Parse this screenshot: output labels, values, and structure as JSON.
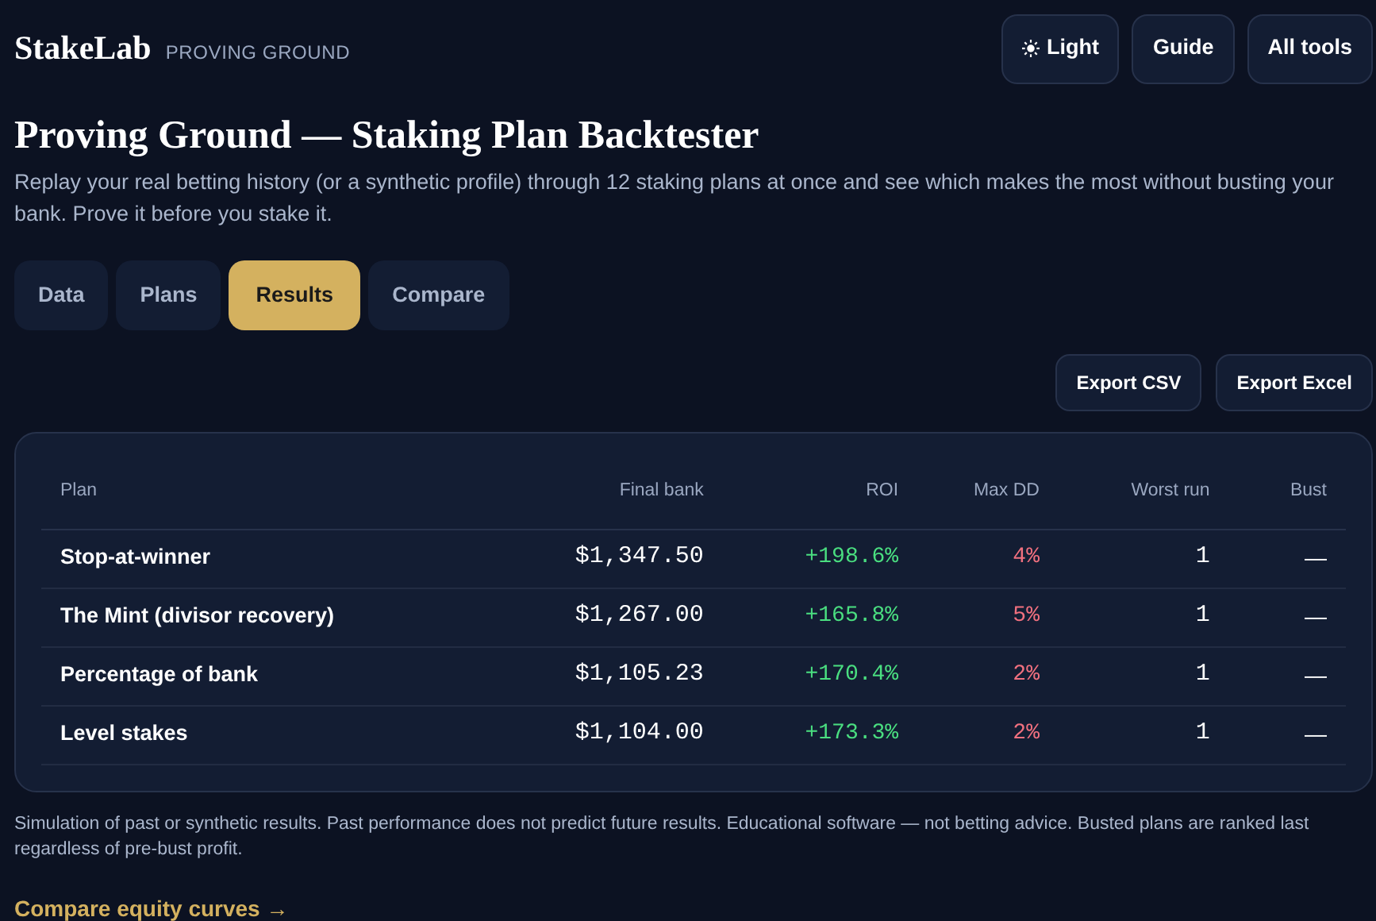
{
  "header": {
    "brand": "StakeLab",
    "subtitle": "PROVING GROUND",
    "buttons": [
      {
        "kind": "theme",
        "label": "Light"
      },
      {
        "kind": "plain",
        "label": "Guide"
      },
      {
        "kind": "plain",
        "label": "All tools"
      }
    ]
  },
  "title": "Proving Ground — Staking Plan Backtester",
  "description": "Replay your real betting history (or a synthetic profile) through 12 staking plans at once and see which makes the most without busting your bank. Prove it before you stake it.",
  "tabs": [
    {
      "label": "Data",
      "selected": false
    },
    {
      "label": "Plans",
      "selected": false
    },
    {
      "label": "Results",
      "selected": true
    },
    {
      "label": "Compare",
      "selected": false
    }
  ],
  "export_buttons": [
    "Export CSV",
    "Export Excel"
  ],
  "table": {
    "columns": [
      "Plan",
      "Final bank",
      "ROI",
      "Max DD",
      "Worst run",
      "Bust"
    ],
    "rows": [
      [
        "Stop-at-winner",
        "$1,347.50",
        "+198.6%",
        "4%",
        "1",
        "—"
      ],
      [
        "The Mint (divisor recovery)",
        "$1,267.00",
        "+165.8%",
        "5%",
        "1",
        "—"
      ],
      [
        "Percentage of bank",
        "$1,105.23",
        "+170.4%",
        "2%",
        "1",
        "—"
      ],
      [
        "Level stakes",
        "$1,104.00",
        "+173.3%",
        "2%",
        "1",
        "—"
      ]
    ]
  },
  "disclaimer": "Simulation of past or synthetic results. Past performance does not predict future results. Educational software — not betting advice. Busted plans are ranked last regardless of pre-bust profit.",
  "link": "Compare equity curves →"
}
